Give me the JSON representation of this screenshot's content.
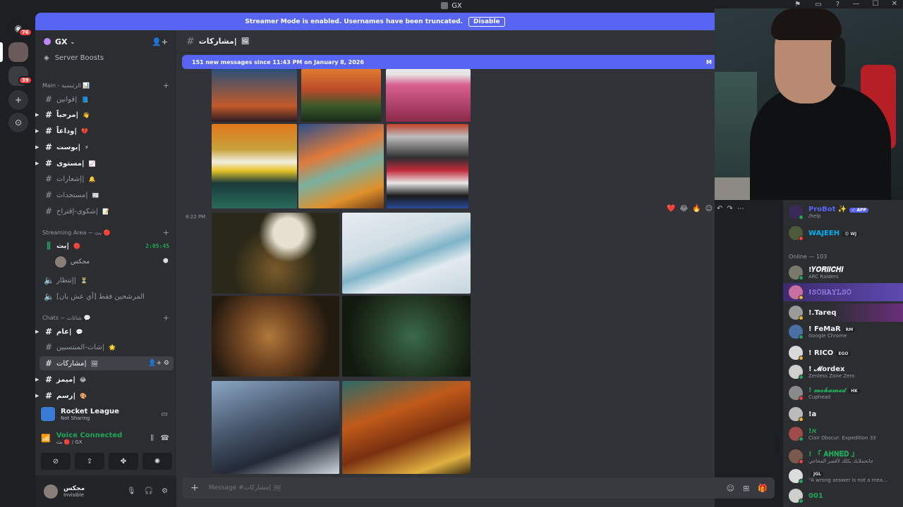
{
  "titlebar": {
    "title": "GX"
  },
  "guilds": {
    "home_badge": "76",
    "folder_badge": "39"
  },
  "streamer": {
    "text": "Streamer Mode is enabled. Usernames have been truncated.",
    "button": "Disable"
  },
  "server": {
    "name": "GX",
    "boosts": "Server Boosts",
    "categories": {
      "main": "Main - الرئيسية 📊",
      "streaming": "Streaming Area ~ بث 🔴",
      "chats": "Chats ~ شاتات 💬"
    },
    "channels_main": [
      {
        "name": "قوانين|",
        "emoji": "📘"
      },
      {
        "name": "مرحباً|",
        "emoji": "👋"
      },
      {
        "name": "وداعاً|",
        "emoji": "💔"
      },
      {
        "name": "بوست|",
        "emoji": "⚡"
      },
      {
        "name": "مستوى|",
        "emoji": "📈"
      },
      {
        "name": "إشعارات|",
        "emoji": "🔔"
      },
      {
        "name": "مستجدات|",
        "emoji": "📰"
      },
      {
        "name": "شكوى-إقتراح|",
        "emoji": "📝"
      }
    ],
    "channels_stream": {
      "live": "بث|",
      "live_emoji": "🔴",
      "timer": "2:05:45",
      "vc_user": "مجكس",
      "wait": "إنتظار|",
      "wait_emoji": "⏳",
      "nominees": "المرشحين فقط [أي عش بان]"
    },
    "channels_chats": [
      {
        "name": "عام|",
        "emoji": "💬"
      },
      {
        "name": "شات-المنتسبين|",
        "emoji": "🌟"
      },
      {
        "name": "مشاركات|",
        "emoji": "🖼"
      },
      {
        "name": "ميمز|",
        "emoji": "😂"
      },
      {
        "name": "رسم|",
        "emoji": "🎨"
      }
    ]
  },
  "activity": {
    "game": "Rocket League",
    "status": "Not Sharing"
  },
  "voice": {
    "label": "Voice Connected",
    "sub": "بث 🔴 / GX"
  },
  "user": {
    "name": "مجكس",
    "status": "Invisible"
  },
  "channel": {
    "name": "مشاركات|",
    "emoji": "🖼"
  },
  "new_messages": {
    "text": "151 new messages since 11:43 PM on January 8, 2026",
    "mark": "M"
  },
  "message": {
    "time": "8:22 PM"
  },
  "reactions": [
    "❤️",
    "😂",
    "🔥"
  ],
  "composer": {
    "placeholder": "Message #مشاركات| 🖼"
  },
  "members": {
    "online_header": "Online — 103",
    "top": [
      {
        "name": "ProBot ✨",
        "tag": "✓ APP",
        "status": "/help",
        "color": "#5865f2",
        "av": "#3a2a5a"
      },
      {
        "name": "WAJEEH",
        "tag": "😠 WJ",
        "status": "",
        "color": "#00b0f4",
        "av": "#4a5a3a"
      }
    ],
    "list": [
      {
        "name": "!𝒀𝑶𝑹𝑰𝑰𝑪𝑯𝑰",
        "status": "ARC Raiders",
        "color": "#f2f3f5",
        "av": "#7a7a6a"
      },
      {
        "name": "!𝚂𝙾𝙷𝙰𝚈𝙻𝚂𝙾",
        "status": "",
        "color": "#a78bfa",
        "av": "#c96fa0"
      },
      {
        "name": "!.Tareq",
        "status": "",
        "color": "#f2f3f5",
        "av": "#9a9a9a"
      },
      {
        "name": "! FeMaR",
        "tag": "RM",
        "status": "Google Chrome",
        "color": "#f2f3f5",
        "av": "#4a6fa5"
      },
      {
        "name": "! RICO",
        "tag": "EGO",
        "status": "",
        "color": "#f2f3f5",
        "av": "#dadada"
      },
      {
        "name": "! 𝓜ordex",
        "status": "Zenless Zone Zero",
        "color": "#f2f3f5",
        "av": "#cfcfcf"
      },
      {
        "name": "! 𝓶𝓸𝓱𝓪𝓶𝓮𝓭",
        "tag": "HK",
        "status": "Cuphead",
        "color": "#23a559",
        "av": "#8a8a8a"
      },
      {
        "name": "!a",
        "status": "",
        "color": "#f2f3f5",
        "av": "#bbbbbb"
      },
      {
        "name": "!אׅ",
        "status": "Clair Obscur: Expedition 33",
        "color": "#23a559",
        "av": "#a04a4a"
      },
      {
        "name": "! 『 𝐀𝐇𝐍𝐄𝐃 』",
        "status": "جانحملايك يكلك لأقصر المحاجي",
        "color": "#23a559",
        "av": "#7a5a4a"
      },
      {
        "name": "",
        "tag": "JGL",
        "status": "\"A wrong answer is not a mea...",
        "color": "#f2f3f5",
        "av": "#dcdcdc"
      },
      {
        "name": "001",
        "status": "",
        "color": "#23a559",
        "av": "#cfcfcf"
      }
    ]
  }
}
